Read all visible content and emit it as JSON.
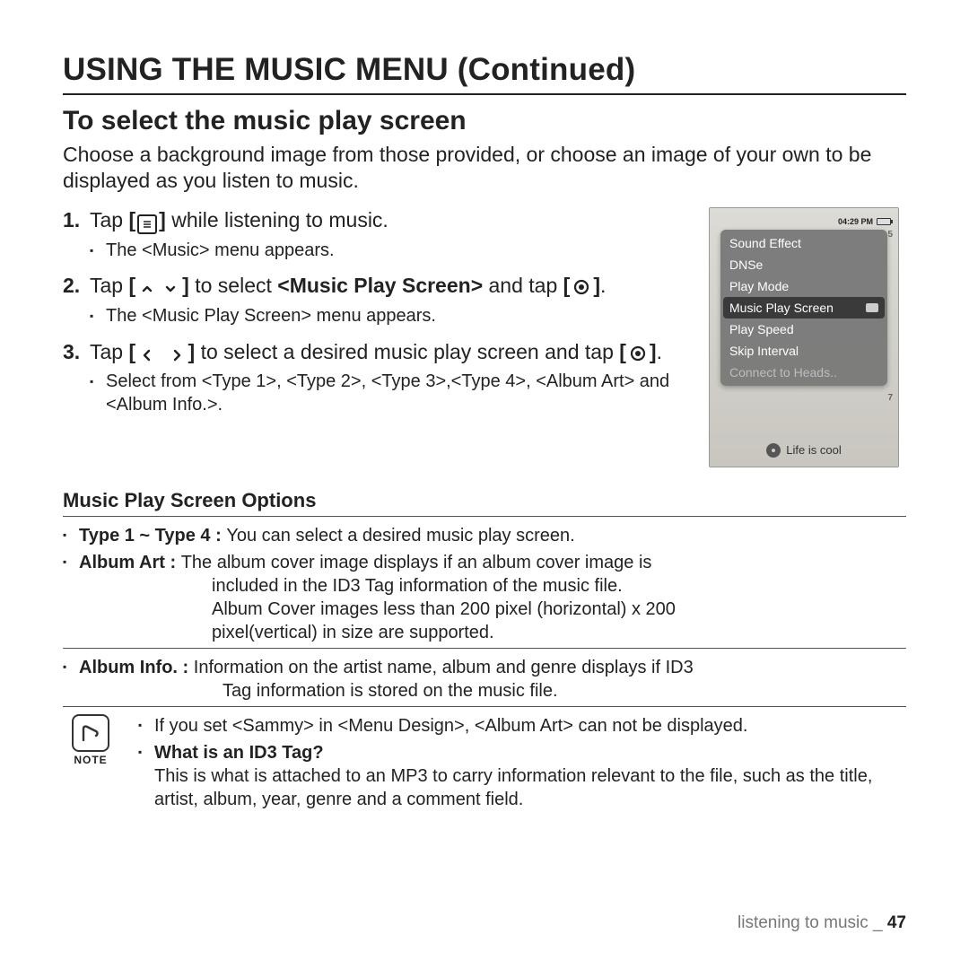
{
  "heading": "USING THE MUSIC MENU (Continued)",
  "subheading": "To select the music play screen",
  "intro": "Choose a background image from those provided, or choose an image of your own to be displayed as you listen to music.",
  "steps": [
    {
      "pre": "Tap ",
      "icon": "menu",
      "post": " while listening to music.",
      "sub": [
        "The <Music> menu appears."
      ]
    },
    {
      "pre": "Tap ",
      "icon": "updown",
      "mid1": " to select ",
      "bold1": "<Music Play Screen>",
      "mid2": " and tap ",
      "icon2": "ok",
      "post": ".",
      "sub": [
        "The <Music Play Screen> menu appears."
      ]
    },
    {
      "pre": "Tap ",
      "icon": "leftright",
      "mid1": " to select a desired music play screen and tap ",
      "icon2": "ok",
      "post": ".",
      "sub": [
        "Select from <Type 1>, <Type 2>, <Type 3>,<Type 4>, <Album Art> and <Album Info.>."
      ]
    }
  ],
  "options_heading": "Music Play Screen Options",
  "options": [
    {
      "term": "Type 1 ~ Type 4 : ",
      "body": "You can select a desired music play screen."
    },
    {
      "term": "Album Art : ",
      "body": "The album cover image displays if an album cover image is included in the ID3 Tag information of the music file. Album Cover images less than 200 pixel (horizontal) x 200 pixel(vertical) in size are supported.",
      "body_line1": "The album cover image displays if an album cover image is",
      "body_line2": "included in the ID3 Tag information of the music file.",
      "body_line3": "Album Cover images less than 200 pixel (horizontal) x 200",
      "body_line4": "pixel(vertical) in size are supported."
    },
    {
      "term": "Album Info. : ",
      "body_line1": "Information on the artist name, album and genre displays if ID3",
      "body_line2": "Tag information is stored on the music file."
    }
  ],
  "note_label": "NOTE",
  "notes": [
    "If you set <Sammy> in <Menu Design>, <Album Art> can not be displayed.",
    {
      "q": "What is an ID3 Tag?",
      "a": "This is what is attached to an MP3 to carry information relevant to the file, such as the title, artist, album, year, genre and a comment field."
    }
  ],
  "device": {
    "time": "04:29 PM",
    "menu": [
      "Sound Effect",
      "DNSe",
      "Play Mode",
      "Music Play Screen",
      "Play Speed",
      "Skip Interval",
      "Connect to Heads.."
    ],
    "selected_index": 3,
    "now_playing": "Life is cool",
    "side_top": "5",
    "side_bottom": "7"
  },
  "footer": {
    "section": "listening to music",
    "sep": " _ ",
    "page": "47"
  }
}
